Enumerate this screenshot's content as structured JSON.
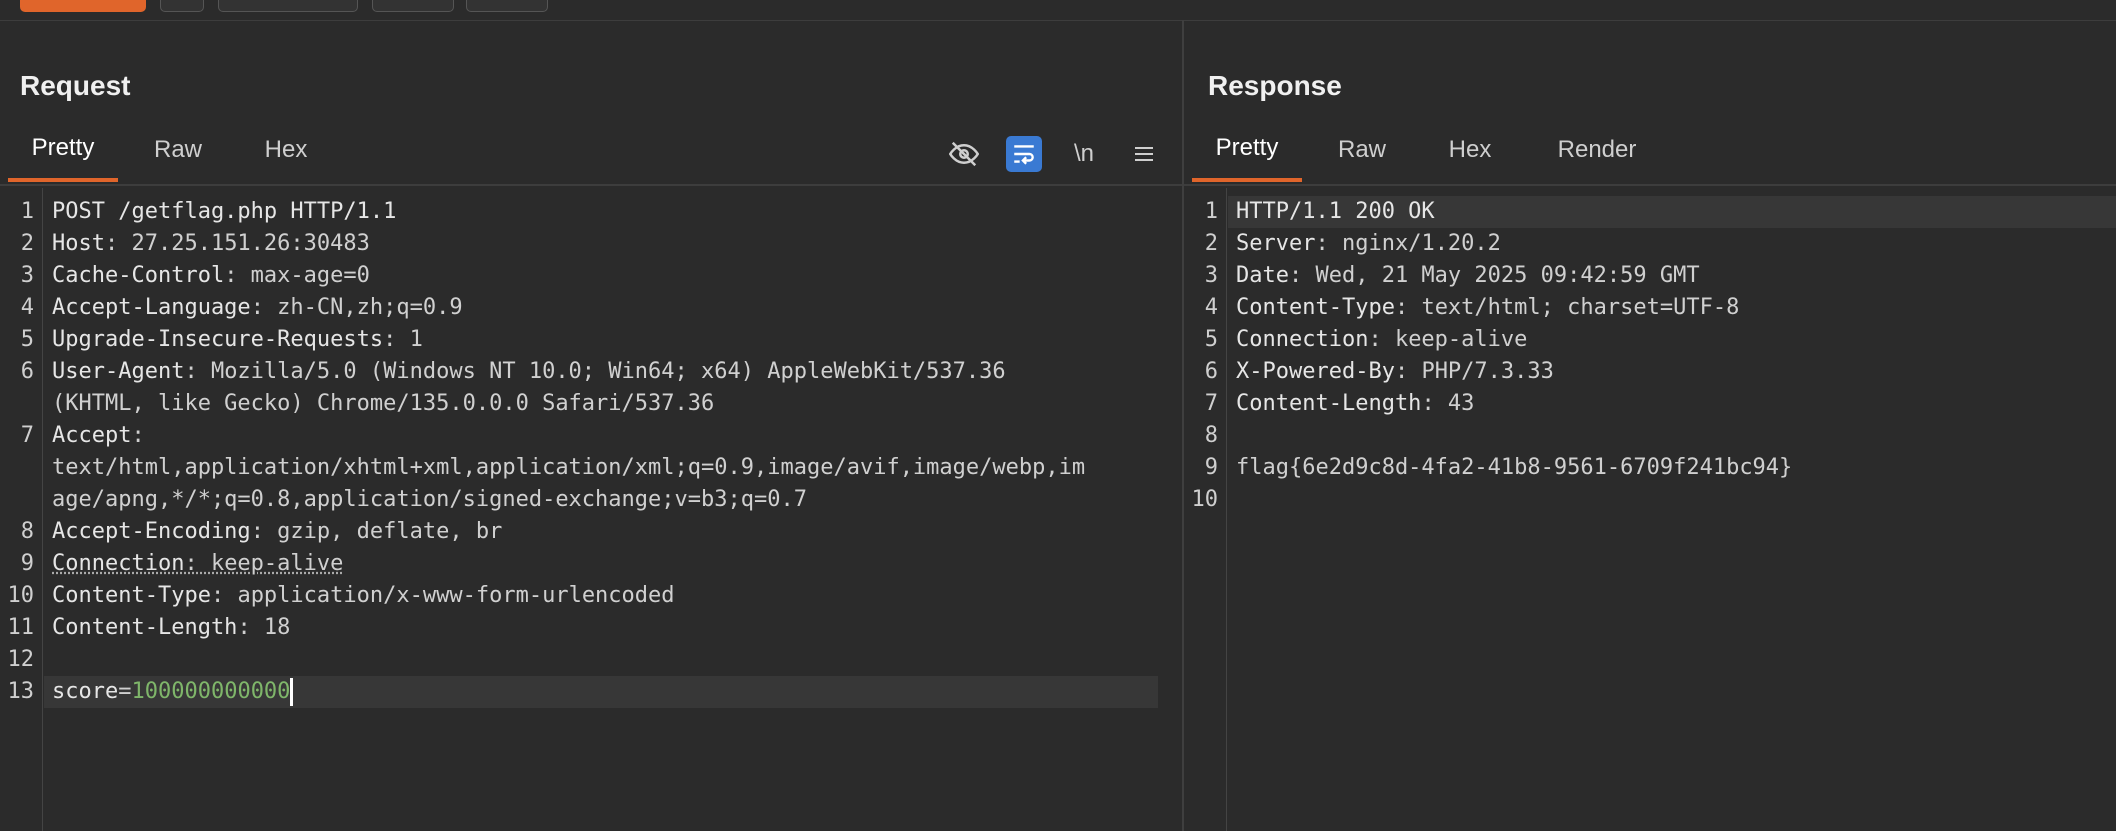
{
  "request": {
    "title": "Request",
    "tabs": [
      "Pretty",
      "Raw",
      "Hex"
    ],
    "active_tab": "Pretty",
    "toolbar": {
      "icons": [
        "eye-slash-icon",
        "wrap-icon",
        "newline-icon",
        "menu-icon"
      ],
      "newline_label": "\\n"
    },
    "lines": [
      {
        "n": "1",
        "key": "POST /getflag.php HTTP/1.1",
        "val": ""
      },
      {
        "n": "2",
        "key": "Host",
        "val": ": 27.25.151.26:30483"
      },
      {
        "n": "3",
        "key": "Cache-Control",
        "val": ": max-age=0"
      },
      {
        "n": "4",
        "key": "Accept-Language",
        "val": ": zh-CN,zh;q=0.9"
      },
      {
        "n": "5",
        "key": "Upgrade-Insecure-Requests",
        "val": ": 1"
      },
      {
        "n": "6",
        "key": "User-Agent",
        "val": ": Mozilla/5.0 (Windows NT 10.0; Win64; x64) AppleWebKit/537.36"
      },
      {
        "n": "",
        "key": "",
        "val": "(KHTML, like Gecko) Chrome/135.0.0.0 Safari/537.36"
      },
      {
        "n": "7",
        "key": "Accept",
        "val": ":"
      },
      {
        "n": "",
        "key": "",
        "val": "text/html,application/xhtml+xml,application/xml;q=0.9,image/avif,image/webp,im"
      },
      {
        "n": "",
        "key": "",
        "val": "age/apng,*/*;q=0.8,application/signed-exchange;v=b3;q=0.7"
      },
      {
        "n": "8",
        "key": "Accept-Encoding",
        "val": ": gzip, deflate, br"
      },
      {
        "n": "9",
        "key": "Connection",
        "val": ": keep-alive"
      },
      {
        "n": "10",
        "key": "Content-Type",
        "val": ": application/x-www-form-urlencoded"
      },
      {
        "n": "11",
        "key": "Content-Length",
        "val": ": 18"
      },
      {
        "n": "12",
        "key": "",
        "val": ""
      },
      {
        "n": "13",
        "key": "score",
        "val": "=",
        "num": "100000000000"
      }
    ]
  },
  "response": {
    "title": "Response",
    "tabs": [
      "Pretty",
      "Raw",
      "Hex",
      "Render"
    ],
    "active_tab": "Pretty",
    "lines": [
      {
        "n": "1",
        "key": "HTTP/1.1 200 OK",
        "val": ""
      },
      {
        "n": "2",
        "key": "Server",
        "val": ": nginx/1.20.2"
      },
      {
        "n": "3",
        "key": "Date",
        "val": ": Wed, 21 May 2025 09:42:59 GMT"
      },
      {
        "n": "4",
        "key": "Content-Type",
        "val": ": text/html; charset=UTF-8"
      },
      {
        "n": "5",
        "key": "Connection",
        "val": ": keep-alive"
      },
      {
        "n": "6",
        "key": "X-Powered-By",
        "val": ": PHP/7.3.33"
      },
      {
        "n": "7",
        "key": "Content-Length",
        "val": ": 43"
      },
      {
        "n": "8",
        "key": "",
        "val": ""
      },
      {
        "n": "9",
        "key": "",
        "val": "flag{6e2d9c8d-4fa2-41b8-9561-6709f241bc94}"
      },
      {
        "n": "10",
        "key": "",
        "val": ""
      }
    ]
  },
  "colors": {
    "accent": "#e0652b",
    "toggle_on": "#3a7ad3",
    "body_value": "#7fb66a"
  }
}
